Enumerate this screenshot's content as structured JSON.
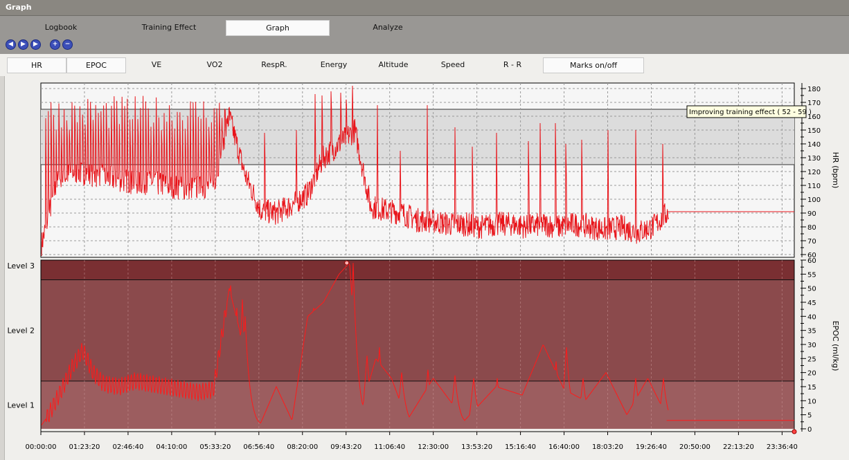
{
  "window": {
    "title": "Graph"
  },
  "main_tabs": [
    {
      "label": "Logbook",
      "active": false
    },
    {
      "label": "Training Effect",
      "active": false
    },
    {
      "label": "Graph",
      "active": true
    },
    {
      "label": "Analyze",
      "active": false
    }
  ],
  "nav_buttons": [
    {
      "name": "previous-icon",
      "glyph": "◀"
    },
    {
      "name": "play-icon",
      "glyph": "▶"
    },
    {
      "name": "next-icon",
      "glyph": "▶"
    },
    {
      "name": "zoom-in-icon",
      "glyph": "+"
    },
    {
      "name": "zoom-out-icon",
      "glyph": "−"
    }
  ],
  "sub_tabs": [
    {
      "label": "HR",
      "active": true
    },
    {
      "label": "EPOC",
      "active": true
    },
    {
      "label": "VE",
      "active": false
    },
    {
      "label": "VO2",
      "active": false
    },
    {
      "label": "RespR.",
      "active": false
    },
    {
      "label": "Energy",
      "active": false
    },
    {
      "label": "Altitude",
      "active": false
    },
    {
      "label": "Speed",
      "active": false
    },
    {
      "label": "R - R",
      "active": false
    },
    {
      "label": "Marks on/off",
      "active": true
    }
  ],
  "tooltip": "Improving training effect ( 52 - 59 )",
  "colors": {
    "line": "#e8141a",
    "hr_zone": "#dcdcdc",
    "epoc_dark": "#7a2f32",
    "epoc_mid": "#8b4a4c",
    "epoc_light": "#9c5d5f"
  },
  "chart_data": [
    {
      "type": "line",
      "ylabel": "HR (bpm)",
      "ylim": [
        58,
        184
      ],
      "yticks": [
        "60",
        "70",
        "80",
        "90",
        "100",
        "110",
        "120",
        "130",
        "140",
        "150",
        "160",
        "170",
        "180"
      ],
      "zone": [
        125,
        165
      ],
      "description_series": "Heart rate, highly oscillating, peaks up to about 182 bpm around 09:50, settling near 91 bpm after 20:00",
      "x": [
        "00:00:00",
        "00:30:00",
        "01:00:00",
        "01:30:00",
        "02:00:00",
        "02:30:00",
        "03:00:00",
        "03:30:00",
        "04:00:00",
        "04:30:00",
        "05:00:00",
        "05:30:00",
        "06:00:00",
        "06:30:00",
        "07:00:00",
        "07:30:00",
        "08:00:00",
        "08:30:00",
        "09:00:00",
        "09:30:00",
        "10:00:00",
        "10:30:00",
        "11:00:00",
        "11:30:00",
        "12:00:00",
        "12:30:00",
        "13:00:00",
        "13:30:00",
        "14:00:00",
        "14:30:00",
        "15:00:00",
        "15:30:00",
        "16:00:00",
        "16:30:00",
        "17:00:00",
        "17:30:00",
        "18:00:00",
        "18:30:00",
        "19:00:00",
        "19:30:00",
        "20:00:00",
        "24:00:00"
      ],
      "series": [
        {
          "values": [
            65,
            112,
            120,
            118,
            116,
            114,
            112,
            112,
            110,
            108,
            108,
            110,
            160,
            118,
            92,
            90,
            96,
            104,
            130,
            140,
            150,
            95,
            92,
            90,
            85,
            84,
            82,
            82,
            80,
            82,
            82,
            80,
            82,
            80,
            82,
            80,
            78,
            80,
            76,
            80,
            91,
            91
          ]
        }
      ]
    },
    {
      "type": "line",
      "ylabel": "EPOC (ml/kg)",
      "ylim": [
        -1,
        60
      ],
      "yticks": [
        "0",
        "5",
        "10",
        "15",
        "20",
        "25",
        "30",
        "35",
        "40",
        "45",
        "50",
        "55",
        "60"
      ],
      "levels": [
        {
          "label": "Level 3",
          "from": 53,
          "to": 60
        },
        {
          "label": "Level 2",
          "from": 17,
          "to": 53
        },
        {
          "label": "Level 1",
          "from": 0,
          "to": 17
        }
      ],
      "x": [
        "00:00:00",
        "00:15:00",
        "00:40:00",
        "01:00:00",
        "01:20:00",
        "01:40:00",
        "02:00:00",
        "02:30:00",
        "03:00:00",
        "03:30:00",
        "04:00:00",
        "04:30:00",
        "05:00:00",
        "05:30:00",
        "06:00:00",
        "06:20:00",
        "06:40:00",
        "07:00:00",
        "07:30:00",
        "08:00:00",
        "08:30:00",
        "09:00:00",
        "09:30:00",
        "09:50:00",
        "10:10:00",
        "10:40:00",
        "11:10:00",
        "11:40:00",
        "12:30:00",
        "13:30:00",
        "14:30:00",
        "15:20:00",
        "16:00:00",
        "16:40:00",
        "17:20:00",
        "18:00:00",
        "18:40:00",
        "19:20:00",
        "20:00:00",
        "24:00:00"
      ],
      "series": [
        {
          "values": [
            1,
            5,
            14,
            22,
            28,
            20,
            16,
            15,
            17,
            16,
            15,
            14,
            13,
            14,
            50,
            35,
            5,
            2,
            15,
            3,
            40,
            45,
            55,
            59,
            5,
            25,
            18,
            3,
            18,
            3,
            15,
            12,
            30,
            14,
            10,
            20,
            5,
            18,
            3,
            3
          ]
        }
      ]
    }
  ],
  "x_ticks": [
    "00:00:00",
    "01:23:20",
    "02:46:40",
    "04:10:00",
    "05:33:20",
    "06:56:40",
    "08:20:00",
    "09:43:20",
    "11:06:40",
    "12:30:00",
    "13:53:20",
    "15:16:40",
    "16:40:00",
    "18:03:20",
    "19:26:40",
    "20:50:00",
    "22:13:20",
    "23:36:40"
  ]
}
